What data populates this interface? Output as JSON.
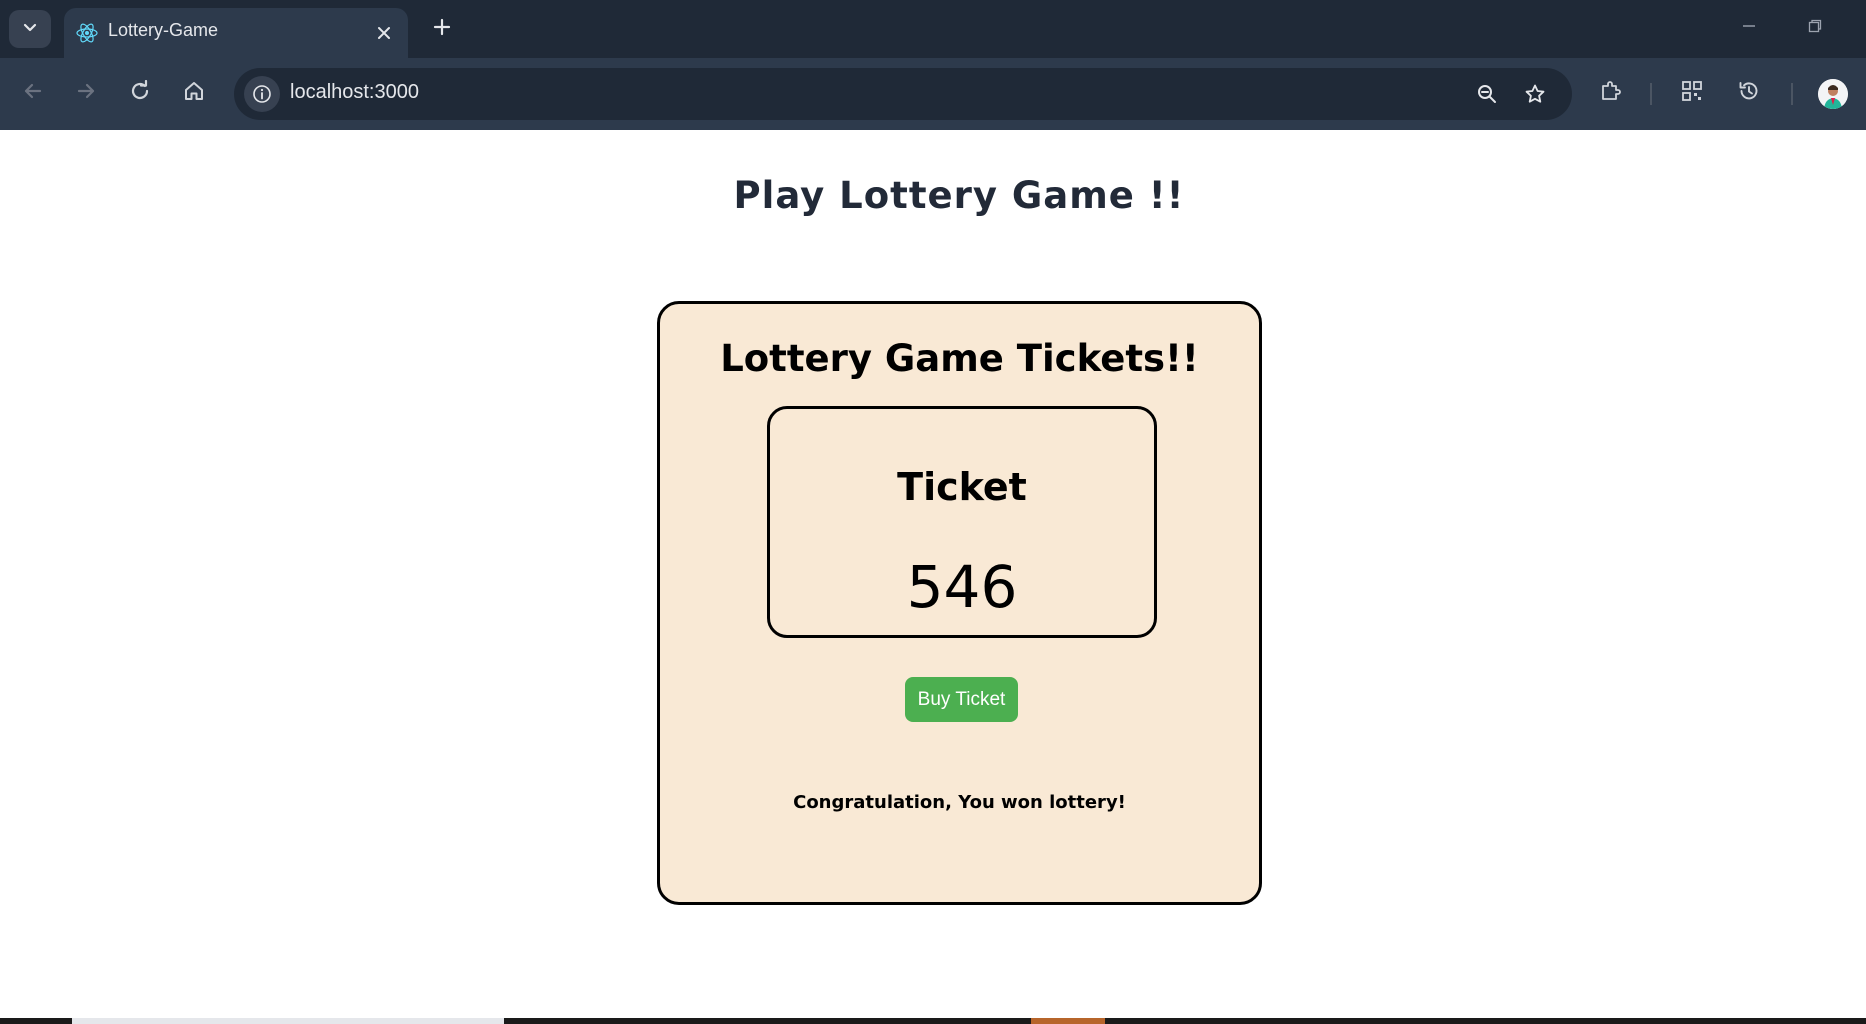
{
  "browser": {
    "tab_title": "Lottery-Game",
    "url": "localhost:3000",
    "icons": [
      "chevron-down-icon",
      "react-icon",
      "close-icon",
      "plus-icon",
      "back-icon",
      "forward-icon",
      "reload-icon",
      "home-icon",
      "info-icon",
      "zoom-icon",
      "star-icon",
      "extensions-icon",
      "qr-code-icon",
      "history-icon",
      "minimize-icon",
      "restore-icon"
    ]
  },
  "page": {
    "title": "Play Lottery Game !!",
    "card_title": "Lottery Game Tickets!!",
    "ticket_label": "Ticket",
    "ticket_number": "546",
    "buy_button": "Buy Ticket",
    "result_message": "Congratulation, You won lottery!"
  },
  "colors": {
    "card_background": "#f9e9d5",
    "button": "#4caf50",
    "chrome_dark": "#1f2937",
    "chrome_toolbar": "#2d3a4c"
  }
}
